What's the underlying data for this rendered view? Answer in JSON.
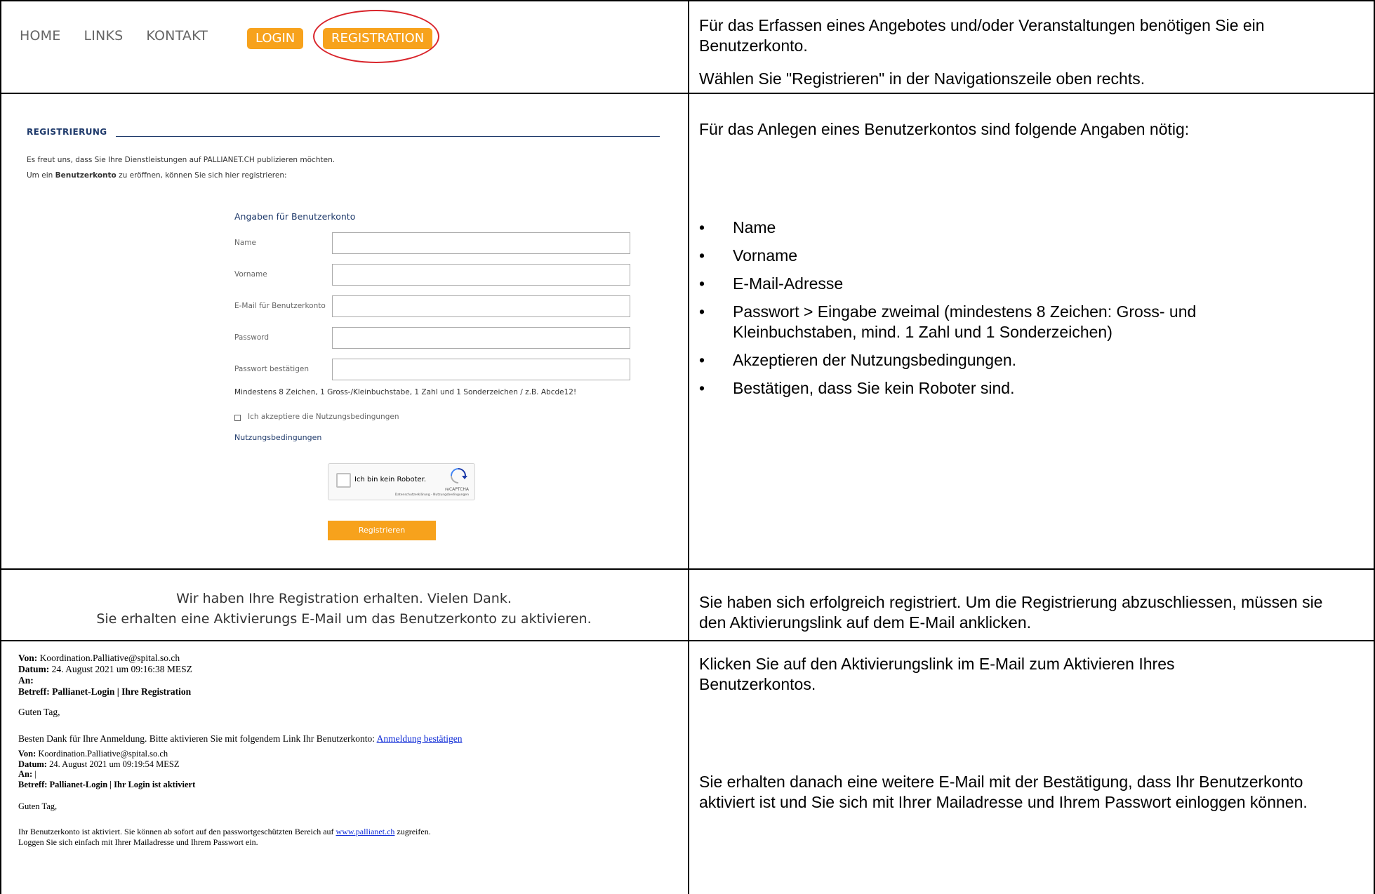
{
  "row1": {
    "nav": [
      "HOME",
      "LINKS",
      "KONTAKT"
    ],
    "login_label": "LOGIN",
    "registration_label": "REGISTRATION",
    "right_p1": "Für das Erfassen eines Angebotes und/oder Veranstaltungen benötigen Sie ein Benutzerkonto.",
    "right_p2": "Wählen Sie \"Registrieren\" in der Navigationszeile oben rechts."
  },
  "row2": {
    "title": "REGISTRIERUNG",
    "intro1": "Es freut uns, dass Sie Ihre Dienstleistungen auf PALLIANET.CH publizieren möchten.",
    "intro2_pre": "Um ein ",
    "intro2_bold": "Benutzerkonto",
    "intro2_post": " zu eröffnen, können Sie sich hier registrieren:",
    "form_heading": "Angaben für Benutzerkonto",
    "fields": {
      "name": "Name",
      "vorname": "Vorname",
      "email": "E-Mail für Benutzerkonto",
      "password": "Password",
      "confirm": "Passwort bestätigen"
    },
    "hint": "Mindestens 8 Zeichen, 1 Gross-/Kleinbuchstabe, 1 Zahl und 1 Sonderzeichen / z.B. Abcde12!",
    "accept_label": "Ich akzeptiere die Nutzungsbedingungen",
    "terms_link": "Nutzungsbedingungen",
    "captcha_label": "Ich bin kein Roboter.",
    "captcha_brand": "reCAPTCHA",
    "captcha_links": "Datenschutzerklärung - Nutzungsbedingungen",
    "submit_label": "Registrieren",
    "right_intro": "Für das Anlegen eines Benutzerkontos sind folgende Angaben nötig:",
    "bullets": [
      "Name",
      "Vorname",
      "E-Mail-Adresse",
      "Passwort > Eingabe zweimal (mindestens 8 Zeichen: Gross- und Kleinbuchstaben, mind. 1 Zahl und 1 Sonderzeichen)",
      "Akzeptieren der Nutzungsbedingungen.",
      "Bestätigen, dass Sie kein Roboter sind."
    ]
  },
  "row3": {
    "line1": "Wir haben Ihre Registration erhalten. Vielen Dank.",
    "line2": "Sie erhalten eine Aktivierungs E-Mail um das Benutzerkonto zu aktivieren.",
    "right": "Sie haben sich erfolgreich registriert. Um die Registrierung abzuschliessen, müssen sie den Aktivierungslink auf dem E-Mail anklicken."
  },
  "row4": {
    "mail1": {
      "von_label": "Von:",
      "von": " Koordination.Palliative@spital.so.ch",
      "datum_label": "Datum:",
      "datum": " 24. August 2021 um 09:16:38 MESZ",
      "an_label": "An:",
      "betreff": "Betreff: Pallianet-Login | Ihre Registration",
      "greeting": "Guten Tag,",
      "body": "Besten Dank für Ihre Anmeldung. Bitte aktivieren Sie mit folgendem Link Ihr Benutzerkonto: ",
      "link": "Anmeldung bestätigen"
    },
    "mail2": {
      "von_label": "Von:",
      "von": " Koordination.Palliative@spital.so.ch",
      "datum_label": "Datum:",
      "datum": " 24. August 2021 um 09:19:54 MESZ",
      "an_label": "An:",
      "an_value": " |",
      "betreff": "Betreff: Pallianet-Login | Ihr Login ist aktiviert",
      "greeting": "Guten Tag,",
      "body1_pre": "Ihr Benutzerkonto ist aktiviert. Sie können ab sofort auf den passwortgeschützten Bereich auf ",
      "body1_link": "www.pallianet.ch",
      "body1_post": " zugreifen.",
      "body2": "Loggen Sie sich einfach mit Ihrer Mailadresse und Ihrem Passwort ein."
    },
    "right1": "Klicken Sie auf den Aktivierungslink im E-Mail zum Aktivieren Ihres Benutzerkontos.",
    "right2": "Sie erhalten danach eine weitere E-Mail mit der Bestätigung, dass Ihr Benutzerkonto aktiviert ist und Sie sich mit Ihrer Mailadresse und Ihrem Passwort einloggen können."
  }
}
